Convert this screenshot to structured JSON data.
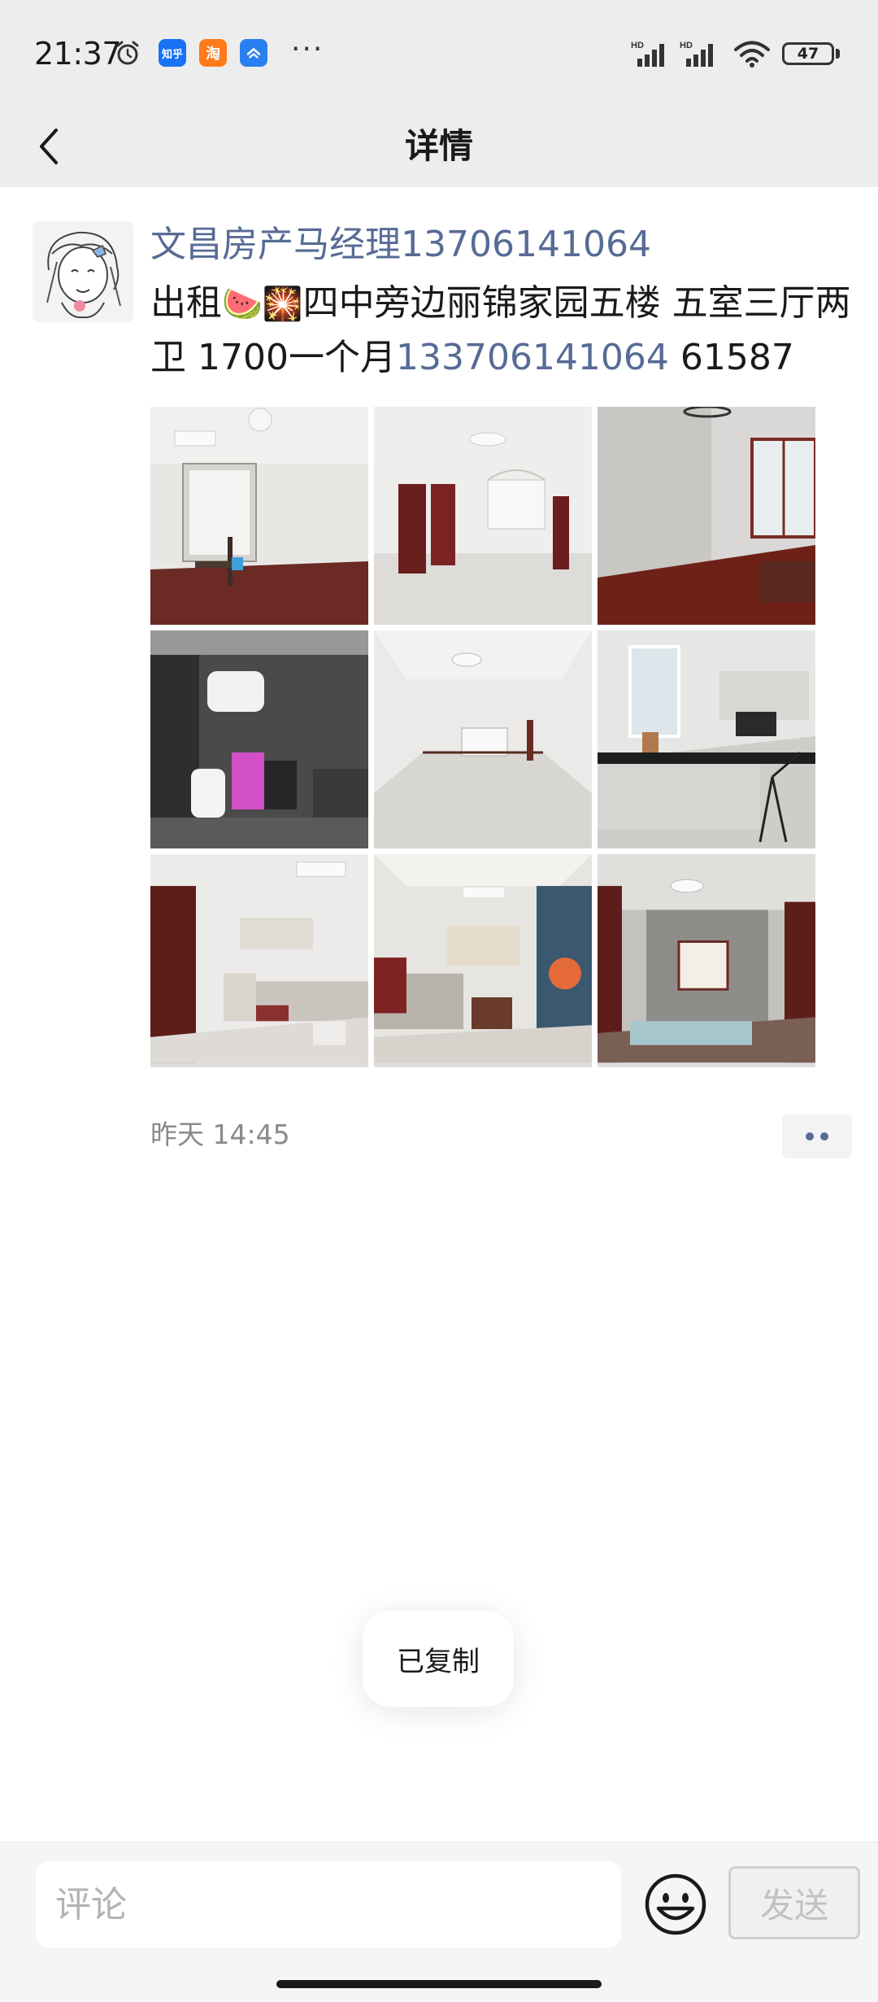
{
  "status_bar": {
    "time": "21:37",
    "apps": [
      {
        "name": "zhihu",
        "label": "知乎"
      },
      {
        "name": "taobao",
        "label": "淘"
      },
      {
        "name": "shield",
        "label": ""
      }
    ],
    "more": "···",
    "signal_labels": [
      "HD",
      "HD"
    ],
    "battery_level": "47"
  },
  "header": {
    "title": "详情"
  },
  "post": {
    "author": "文昌房产马经理13706141064",
    "text_prefix": "出租",
    "emoji_1": "🍉",
    "emoji_2": "🎇",
    "text_middle": "四中旁边丽锦家园五楼  五室三厅两卫  1700一个月",
    "phone": "133706141064",
    "text_suffix": "  61587",
    "photo_count": 9,
    "time": "昨天 14:45"
  },
  "toast": {
    "message": "已复制"
  },
  "comment_bar": {
    "placeholder": "评论",
    "send_label": "发送"
  },
  "colors": {
    "link": "#576b95",
    "header_bg": "#ededed",
    "bottom_bg": "#f5f5f5"
  }
}
